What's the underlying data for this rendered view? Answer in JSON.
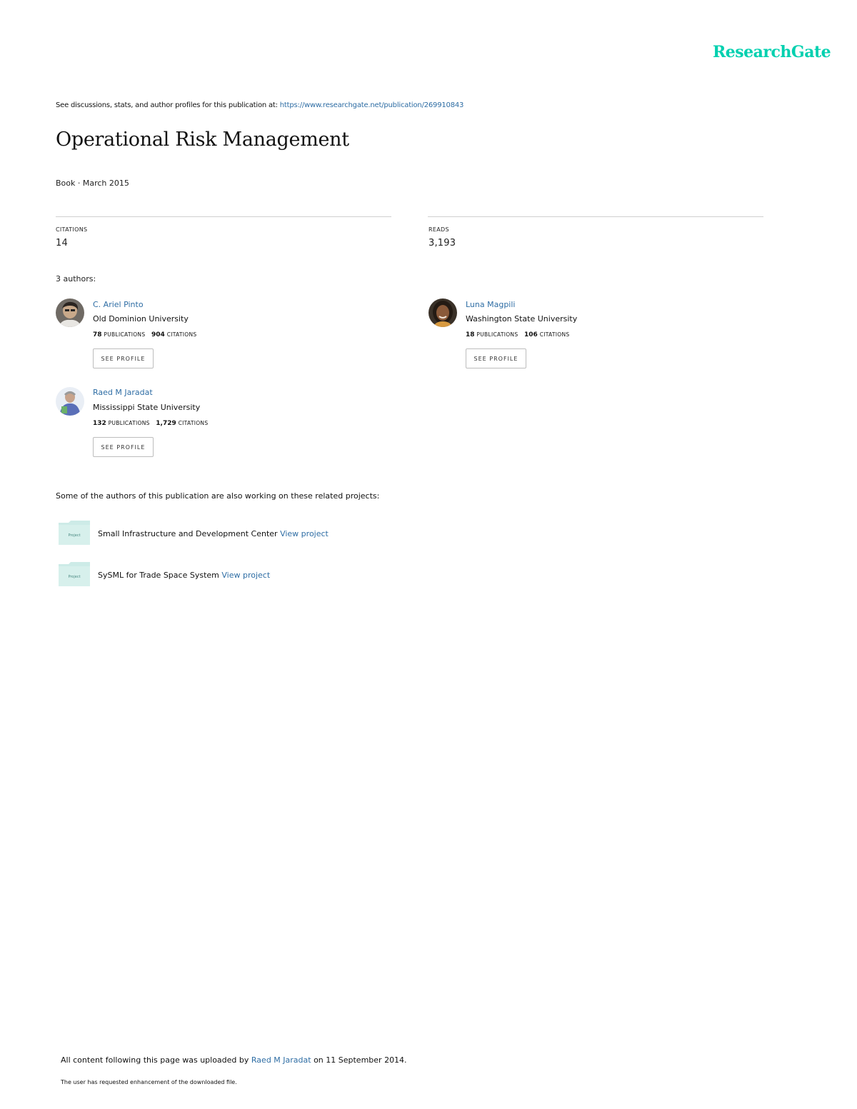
{
  "brand": {
    "logo_text": "ResearchGate",
    "color": "#00d0af"
  },
  "header": {
    "discussion_text": "See discussions, stats, and author profiles for this publication at: ",
    "publication_url": "https://www.researchgate.net/publication/269910843"
  },
  "publication": {
    "title": "Operational Risk Management",
    "type_date": "Book · March 2015"
  },
  "stats": {
    "citations_label": "CITATIONS",
    "citations_value": "14",
    "reads_label": "READS",
    "reads_value": "3,193"
  },
  "authors_heading": "3 authors:",
  "authors": [
    {
      "name": "C. Ariel Pinto",
      "institution": "Old Dominion University",
      "publications_count": "78",
      "publications_label": "PUBLICATIONS",
      "citations_count": "904",
      "citations_label": "CITATIONS",
      "button_label": "SEE PROFILE"
    },
    {
      "name": "Luna Magpili",
      "institution": "Washington State University",
      "publications_count": "18",
      "publications_label": "PUBLICATIONS",
      "citations_count": "106",
      "citations_label": "CITATIONS",
      "button_label": "SEE PROFILE"
    },
    {
      "name": "Raed M Jaradat",
      "institution": "Mississippi State University",
      "publications_count": "132",
      "publications_label": "PUBLICATIONS",
      "citations_count": "1,729",
      "citations_label": "CITATIONS",
      "button_label": "SEE PROFILE"
    }
  ],
  "projects_intro": "Some of the authors of this publication are also working on these related projects:",
  "projects": [
    {
      "icon_label": "Project",
      "name": "Small Infrastructure and Development Center",
      "link_text": "View project"
    },
    {
      "icon_label": "Project",
      "name": "SySML for Trade Space System",
      "link_text": "View project"
    }
  ],
  "footer": {
    "uploaded_prefix": "All content following this page was uploaded by ",
    "uploader": "Raed M Jaradat",
    "uploaded_suffix": " on 11 September 2014.",
    "notice": "The user has requested enhancement of the downloaded file."
  }
}
